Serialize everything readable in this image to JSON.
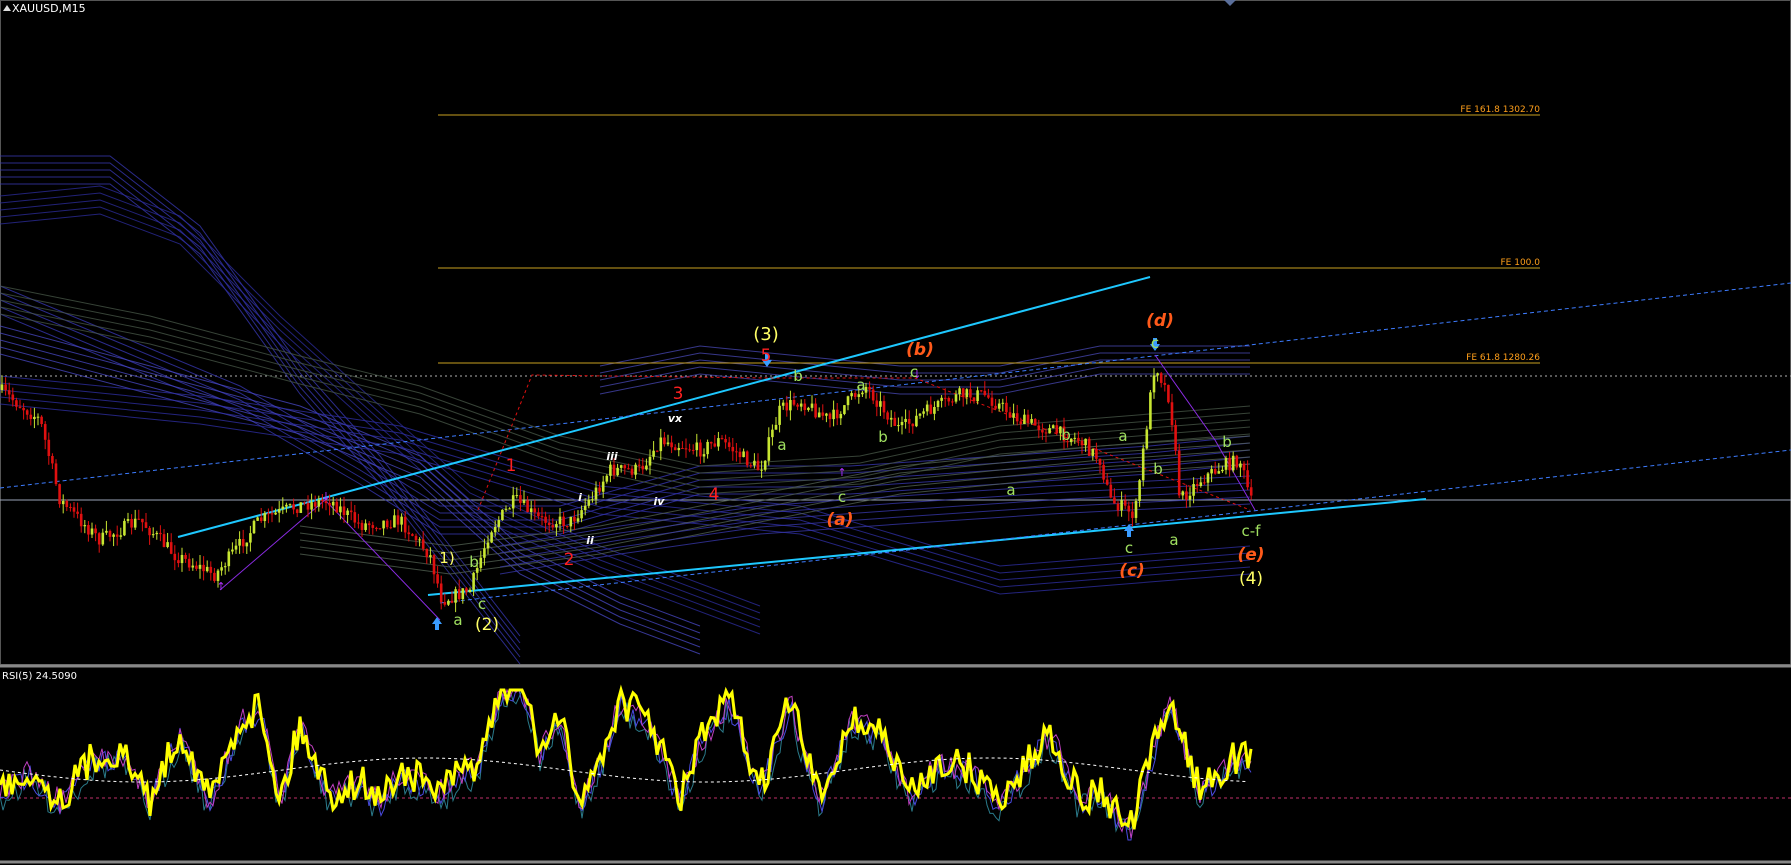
{
  "header": {
    "symbol": "XAUUSD,M15"
  },
  "indicator": {
    "label": "RSI(5) 24.5090"
  },
  "colors": {
    "bg": "#000000",
    "bull": "#c8e632",
    "bear": "#e01010",
    "fe_line": "#c8a020",
    "fe_text": "#ff9f1a",
    "trend": "#1ec8ff",
    "rsi": "#ffff00",
    "wave_yellow": "#ffff66",
    "wave_red": "#ff2020",
    "wave_green": "#a0e060",
    "wave_orange": "#ff5a1a",
    "wave_white": "#ffffff"
  },
  "fibo_levels": [
    {
      "label": "FE 161.8 1302.70"
    },
    {
      "label": "FE 100.0"
    },
    {
      "label": "FE 61.8 1280.26"
    }
  ],
  "wave_labels": [
    {
      "text": "(3)",
      "color": "yellow"
    },
    {
      "text": "5",
      "color": "red"
    },
    {
      "text": "3",
      "color": "red"
    },
    {
      "text": "1",
      "color": "red"
    },
    {
      "text": "2",
      "color": "red"
    },
    {
      "text": "4",
      "color": "red"
    },
    {
      "text": "vx",
      "color": "white"
    },
    {
      "text": "iii",
      "color": "white"
    },
    {
      "text": "i",
      "color": "white"
    },
    {
      "text": "ii",
      "color": "white"
    },
    {
      "text": "iv",
      "color": "white"
    },
    {
      "text": "1)",
      "color": "yellow"
    },
    {
      "text": "b",
      "color": "green"
    },
    {
      "text": "c",
      "color": "green"
    },
    {
      "text": "a",
      "color": "green"
    },
    {
      "text": "(2)",
      "color": "yellow"
    },
    {
      "text": "b",
      "color": "green"
    },
    {
      "text": "a",
      "color": "green"
    },
    {
      "text": "a",
      "color": "green"
    },
    {
      "text": "b",
      "color": "green"
    },
    {
      "text": "c",
      "color": "green"
    },
    {
      "text": "(a)",
      "color": "orange"
    },
    {
      "text": "(b)",
      "color": "orange"
    },
    {
      "text": "c",
      "color": "green"
    },
    {
      "text": "b",
      "color": "green"
    },
    {
      "text": "a",
      "color": "green"
    },
    {
      "text": "(d)",
      "color": "orange"
    },
    {
      "text": "c",
      "color": "green"
    },
    {
      "text": "a",
      "color": "green"
    },
    {
      "text": "b",
      "color": "green"
    },
    {
      "text": "c",
      "color": "green"
    },
    {
      "text": "(c)",
      "color": "orange"
    },
    {
      "text": "a",
      "color": "green"
    },
    {
      "text": "b",
      "color": "green"
    },
    {
      "text": "c-f",
      "color": "green"
    },
    {
      "text": "(e)",
      "color": "orange"
    },
    {
      "text": "(4)",
      "color": "yellow"
    }
  ]
}
